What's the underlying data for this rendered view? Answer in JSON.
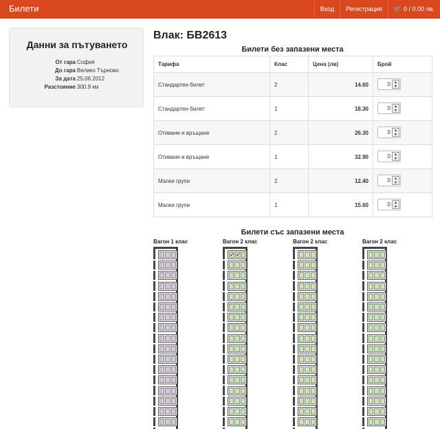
{
  "navbar": {
    "brand": "Билети",
    "login": "Вход",
    "register": "Регистрация",
    "cart": "0 / 0.00 лв.",
    "cart_icon": "cart-icon",
    "color": "#d9481c"
  },
  "sidebar": {
    "title": "Данни за пътуването",
    "rows": [
      {
        "label": "От гара",
        "value": "София"
      },
      {
        "label": "До гара",
        "value": "Велико Търново"
      },
      {
        "label": "За дата",
        "value": "25.06.2012"
      },
      {
        "label": "Разстояние",
        "value": "300.9 км"
      }
    ]
  },
  "train": {
    "title": "Влак: БВ2613"
  },
  "unreserved": {
    "title": "Билети без запазени места",
    "headers": [
      "Тарифа",
      "Клас",
      "Цена (лв)",
      "Брой"
    ],
    "rows": [
      {
        "tariff": "Стандартен билет",
        "class": "2",
        "price": "14.60",
        "count": "0"
      },
      {
        "tariff": "Стандартен билет",
        "class": "1",
        "price": "18.30",
        "count": "0"
      },
      {
        "tariff": "Отиване и връщане",
        "class": "2",
        "price": "26.30",
        "count": "0"
      },
      {
        "tariff": "Отиване и връщане",
        "class": "1",
        "price": "32.90",
        "count": "0"
      },
      {
        "tariff": "Малки групи",
        "class": "2",
        "price": "12.40",
        "count": "0"
      },
      {
        "tariff": "Малки групи",
        "class": "1",
        "price": "15.60",
        "count": "0"
      }
    ]
  },
  "reserved": {
    "title": "Билети със запазени места",
    "wagons": [
      {
        "label": "Вагон 1 клас",
        "class": "first"
      },
      {
        "label": "Вагон 2 клас",
        "class": "second"
      },
      {
        "label": "Вагон 2 клас",
        "class": "second"
      },
      {
        "label": "Вагон 2 клас",
        "class": "second"
      }
    ],
    "checked_marks": "✓✓"
  }
}
